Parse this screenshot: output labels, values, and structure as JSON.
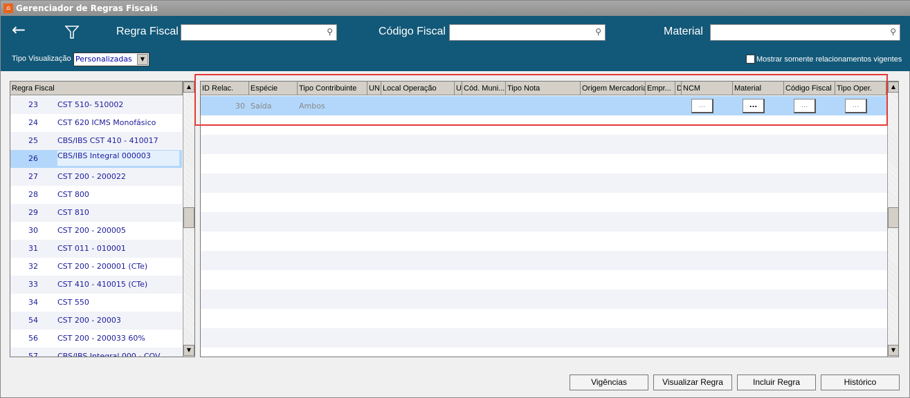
{
  "window": {
    "title": "Gerenciador de Regras Fiscais"
  },
  "header": {
    "regra_label": "Regra Fiscal",
    "regra_value": "",
    "codigo_label": "Código Fiscal",
    "codigo_value": "",
    "material_label": "Material",
    "material_value": "",
    "tipo_label": "Tipo Visualização",
    "tipo_value": "Personalizadas",
    "vigentes_label": "Mostrar somente relacionamentos vigentes",
    "vigentes_checked": false
  },
  "left": {
    "header": "Regra Fiscal",
    "items": [
      {
        "id": "23",
        "name": "CST 510- 510002"
      },
      {
        "id": "24",
        "name": "CST 620 ICMS Monofásico"
      },
      {
        "id": "25",
        "name": "CBS/IBS CST 410 - 410017"
      },
      {
        "id": "26",
        "name": "CBS/IBS Integral 000003"
      },
      {
        "id": "27",
        "name": "CST 200 - 200022"
      },
      {
        "id": "28",
        "name": "CST 800"
      },
      {
        "id": "29",
        "name": "CST 810"
      },
      {
        "id": "30",
        "name": "CST 200 - 200005"
      },
      {
        "id": "31",
        "name": "CST 011 - 010001"
      },
      {
        "id": "32",
        "name": "CST 200 - 200001 (CTe)"
      },
      {
        "id": "33",
        "name": "CST 410 - 410015 (CTe)"
      },
      {
        "id": "34",
        "name": "CST 550"
      },
      {
        "id": "54",
        "name": "CST 200 - 20003"
      },
      {
        "id": "56",
        "name": "CST 200 - 200033 60%"
      },
      {
        "id": "57",
        "name": "CBS/IBS Integral 000 - COV"
      }
    ],
    "selected": "26"
  },
  "grid": {
    "columns": [
      "ID Relac.",
      "Espécie",
      "Tipo Contribuinte",
      "UN",
      "Local Operação",
      "U",
      "Cód. Muni...",
      "Tipo Nota",
      "Origem Mercadoria",
      "Empr...",
      "D",
      "NCM",
      "Material",
      "Código Fiscal",
      "Tipo Oper."
    ],
    "rows": [
      {
        "id": "30",
        "especie": "Saída",
        "tipo_contribuinte": "Ambos",
        "ncm": "...",
        "material": "...",
        "codigo_fiscal": "...",
        "tipo_oper": "..."
      }
    ]
  },
  "buttons": {
    "vigencias": "Vigências",
    "visualizar": "Visualizar Regra",
    "incluir": "Incluir Regra",
    "historico": "Histórico"
  },
  "colors": {
    "header": "#125878",
    "selection": "#b3d7fa",
    "highlight": "#e53935"
  }
}
